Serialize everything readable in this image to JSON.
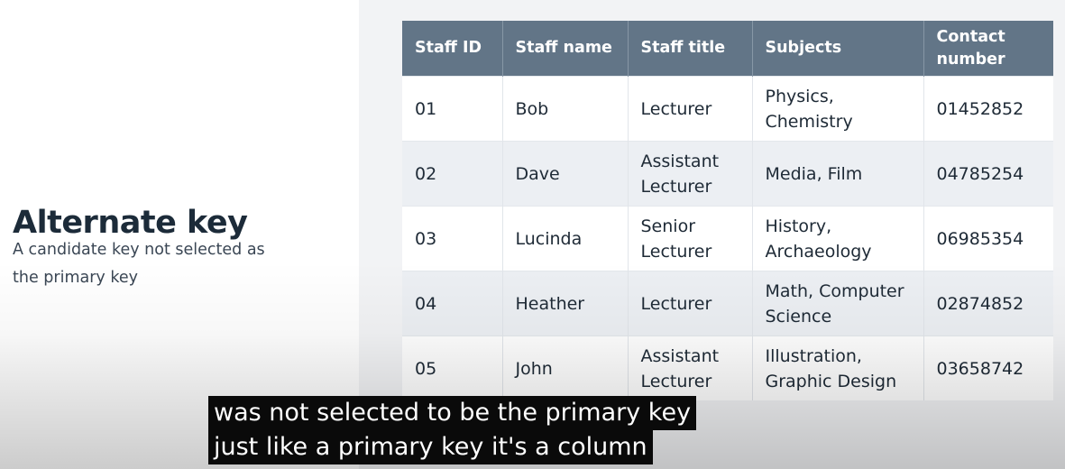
{
  "slide": {
    "heading": "Alternate key",
    "description": "A candidate key not selected as the primary key"
  },
  "table": {
    "columns": [
      "Staff ID",
      "Staff name",
      "Staff title",
      "Subjects",
      "Contact number"
    ],
    "rows": [
      {
        "id": "01",
        "name": "Bob",
        "title": "Lecturer",
        "subjects": "Physics, Chemistry",
        "contact": "01452852"
      },
      {
        "id": "02",
        "name": "Dave",
        "title": "Assistant Lecturer",
        "subjects": "Media, Film",
        "contact": "04785254"
      },
      {
        "id": "03",
        "name": "Lucinda",
        "title": "Senior Lecturer",
        "subjects": "History, Archaeology",
        "contact": "06985354"
      },
      {
        "id": "04",
        "name": "Heather",
        "title": "Lecturer",
        "subjects": "Math, Computer Science",
        "contact": "02874852"
      },
      {
        "id": "05",
        "name": "John",
        "title": "Assistant Lecturer",
        "subjects": "Illustration, Graphic Design",
        "contact": "03658742"
      }
    ]
  },
  "captions": [
    "was not selected to be the primary key",
    "just like a primary key it's a column"
  ],
  "colors": {
    "header_background": "#627587",
    "header_text": "#ffffff",
    "heading_text": "#1c2b39",
    "panel_background": "#f2f3f5",
    "caption_background": "#0a0a0a",
    "caption_text": "#ffffff"
  }
}
